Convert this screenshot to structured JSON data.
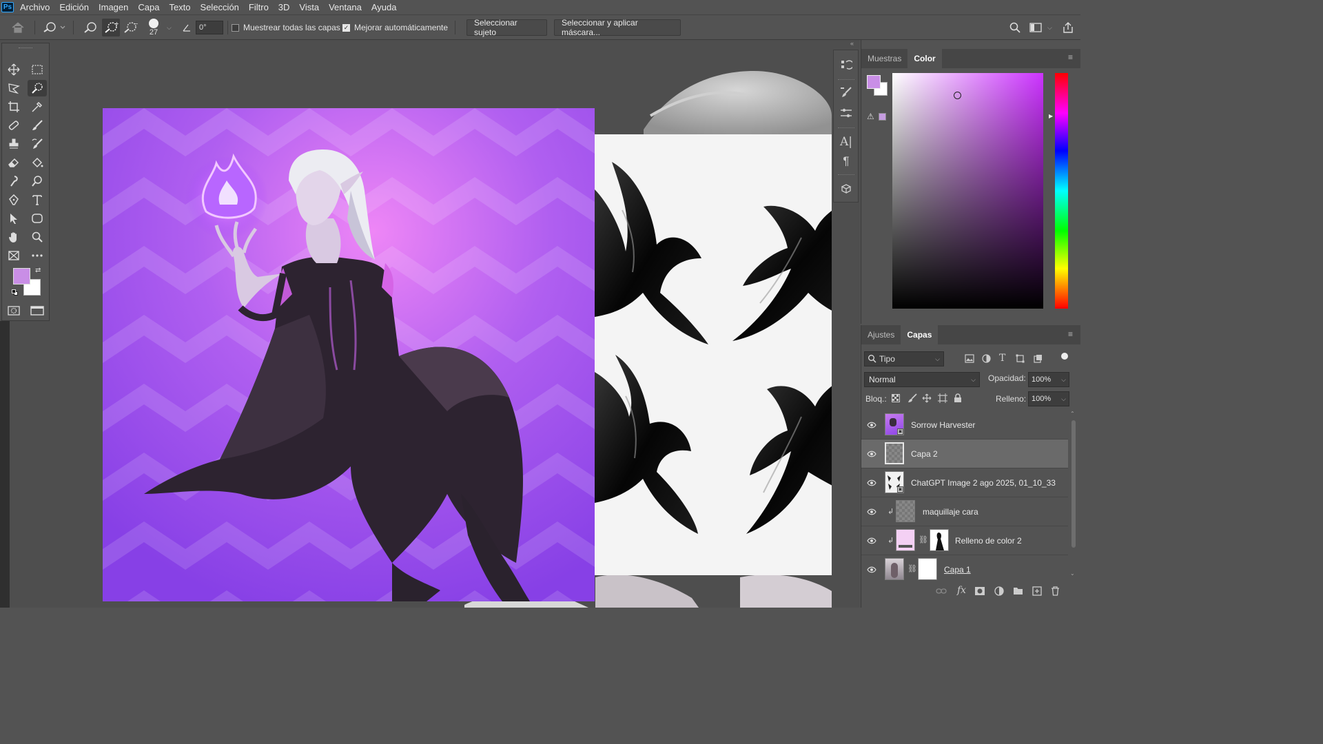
{
  "app": {
    "logo": "Ps"
  },
  "menu": [
    "Archivo",
    "Edición",
    "Imagen",
    "Capa",
    "Texto",
    "Selección",
    "Filtro",
    "3D",
    "Vista",
    "Ventana",
    "Ayuda"
  ],
  "options": {
    "brush_size": "27",
    "angle": "0°",
    "sample_all_layers": "Muestrear todas las capas",
    "auto_enhance": "Mejorar automáticamente",
    "select_subject": "Seleccionar sujeto",
    "select_and_mask": "Seleccionar y aplicar máscara..."
  },
  "colors": {
    "foreground": "#c98ee6",
    "background": "#ffffff",
    "accent": "#31a8ff"
  },
  "color_panel": {
    "tabs": [
      "Muestras",
      "Color"
    ],
    "active_tab": "Color"
  },
  "layers_panel": {
    "tabs": [
      "Ajustes",
      "Capas"
    ],
    "active_tab": "Capas",
    "filter_label": "Tipo",
    "blend_mode": "Normal",
    "opacity_label": "Opacidad:",
    "opacity_value": "100%",
    "lock_label": "Bloq.:",
    "fill_label": "Relleno:",
    "fill_value": "100%",
    "layers": [
      {
        "name": "Sorrow Harvester",
        "type": "smart-object",
        "selected": false
      },
      {
        "name": "Capa 2",
        "type": "pixel",
        "selected": true
      },
      {
        "name": "ChatGPT Image 2 ago 2025, 01_10_33",
        "type": "smart-object",
        "selected": false
      },
      {
        "name": "maquillaje cara",
        "type": "pixel-clipped",
        "selected": false
      },
      {
        "name": "Relleno de color 2",
        "type": "fill-with-mask",
        "selected": false
      },
      {
        "name": "Capa 1",
        "type": "pixel-with-mask",
        "selected": false
      }
    ]
  }
}
